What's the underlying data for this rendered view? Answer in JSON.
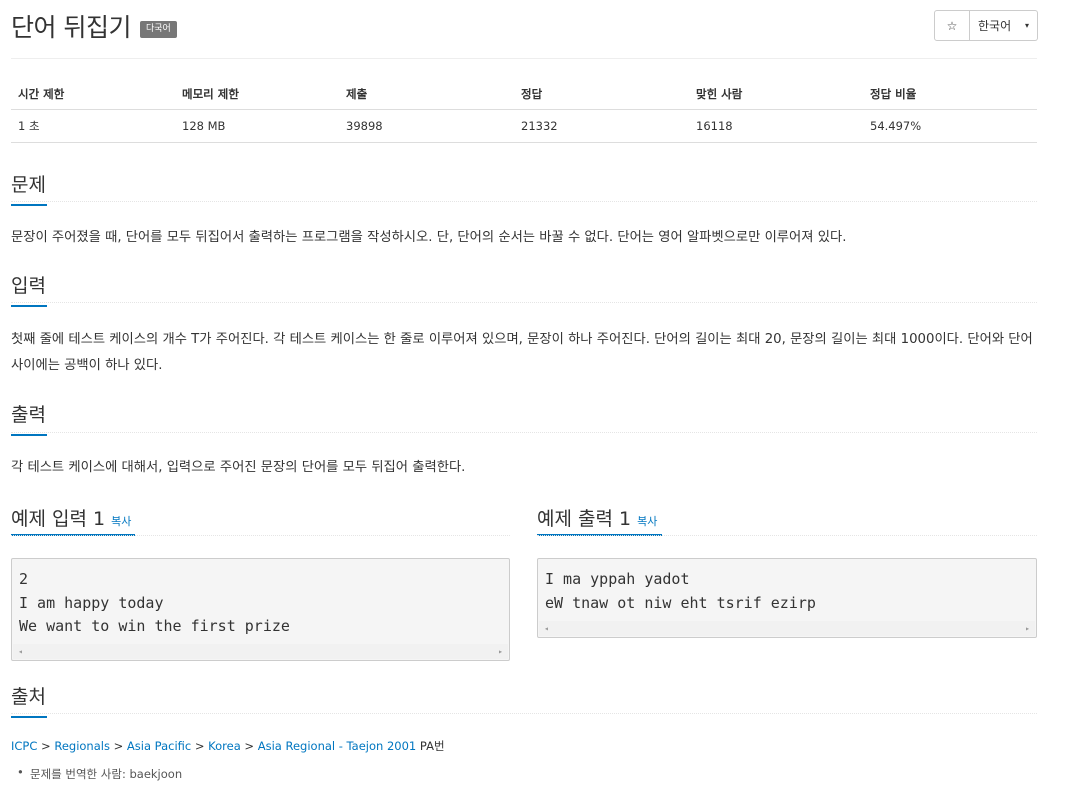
{
  "header": {
    "title": "단어 뒤집기",
    "badge": "다국어",
    "star_icon": "☆",
    "language": "한국어",
    "caret_icon": "▾"
  },
  "stats": {
    "headers": [
      "시간 제한",
      "메모리 제한",
      "제출",
      "정답",
      "맞힌 사람",
      "정답 비율"
    ],
    "values": [
      "1 초",
      "128 MB",
      "39898",
      "21332",
      "16118",
      "54.497%"
    ]
  },
  "sections": {
    "problem": {
      "title": "문제",
      "body": "문장이 주어졌을 때, 단어를 모두 뒤집어서 출력하는 프로그램을 작성하시오. 단, 단어의 순서는 바꿀 수 없다. 단어는 영어 알파벳으로만 이루어져 있다."
    },
    "input": {
      "title": "입력",
      "body": "첫째 줄에 테스트 케이스의 개수 T가 주어진다. 각 테스트 케이스는 한 줄로 이루어져 있으며, 문장이 하나 주어진다. 단어의 길이는 최대 20, 문장의 길이는 최대 1000이다. 단어와 단어 사이에는 공백이 하나 있다."
    },
    "output": {
      "title": "출력",
      "body": "각 테스트 케이스에 대해서, 입력으로 주어진 문장의 단어를 모두 뒤집어 출력한다."
    },
    "source": {
      "title": "출처"
    }
  },
  "examples": {
    "input": {
      "title": "예제 입력 1",
      "copy": "복사",
      "lines": [
        "2",
        "I am happy today",
        "We want to win the first prize"
      ]
    },
    "output": {
      "title": "예제 출력 1",
      "copy": "복사",
      "lines": [
        "I ma yppah yadot",
        "eW tnaw ot niw eht tsrif ezirp"
      ]
    }
  },
  "scroll_left_icon": "◂",
  "scroll_right_icon": "▸",
  "source_info": {
    "links": [
      "ICPC",
      "Regionals",
      "Asia Pacific",
      "Korea",
      "Asia Regional - Taejon 2001"
    ],
    "separator": " > ",
    "suffix": " PA번",
    "translator": "문제를 번역한 사람: baekjoon"
  },
  "colors": {
    "accent": "#0076c0",
    "badge_bg": "#777777"
  }
}
